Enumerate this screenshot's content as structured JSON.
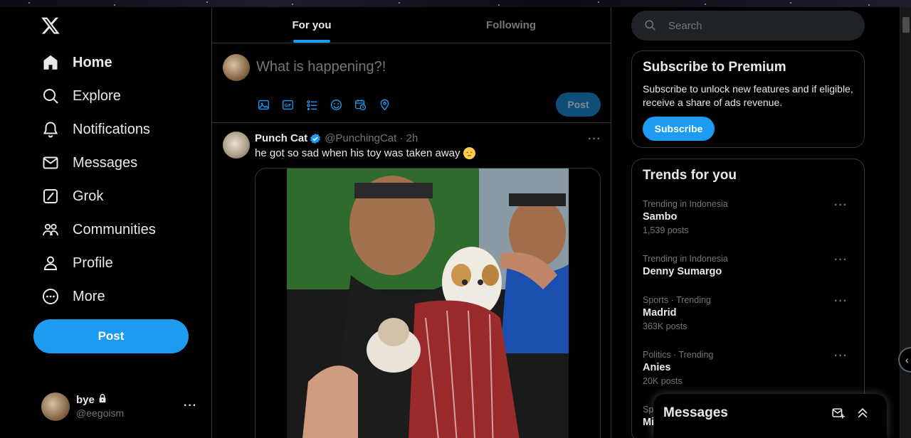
{
  "colors": {
    "accent": "#1d9bf0",
    "bg": "#000000",
    "border": "#2f3336",
    "muted": "#71767b",
    "text": "#e7e9ea"
  },
  "nav": {
    "items": [
      {
        "label": "Home",
        "icon": "home-icon",
        "active": true
      },
      {
        "label": "Explore",
        "icon": "search-icon"
      },
      {
        "label": "Notifications",
        "icon": "bell-icon"
      },
      {
        "label": "Messages",
        "icon": "envelope-icon"
      },
      {
        "label": "Grok",
        "icon": "grok-icon"
      },
      {
        "label": "Communities",
        "icon": "people-icon"
      },
      {
        "label": "Profile",
        "icon": "person-icon"
      },
      {
        "label": "More",
        "icon": "more-circle-icon"
      }
    ],
    "post_label": "Post",
    "account": {
      "name": "bye",
      "handle": "@eegoism"
    }
  },
  "tabs": [
    {
      "label": "For you",
      "active": true
    },
    {
      "label": "Following"
    }
  ],
  "composer": {
    "placeholder": "What is happening?!",
    "post_label": "Post",
    "tools": [
      "image-icon",
      "gif-icon",
      "poll-icon",
      "emoji-icon",
      "schedule-icon",
      "location-icon"
    ]
  },
  "tweet": {
    "name": "Punch Cat",
    "handle": "@PunchingCat · 2h",
    "text": "he got so sad when his toy was taken away"
  },
  "search": {
    "placeholder": "Search"
  },
  "premium": {
    "title": "Subscribe to Premium",
    "body": "Subscribe to unlock new features and if eligible, receive a share of ads revenue.",
    "button": "Subscribe"
  },
  "trends": {
    "title": "Trends for you",
    "items": [
      {
        "context": "Trending in Indonesia",
        "title": "Sambo",
        "count": "1,539 posts"
      },
      {
        "context": "Trending in Indonesia",
        "title": "Denny Sumargo",
        "count": ""
      },
      {
        "context": "Sports · Trending",
        "title": "Madrid",
        "count": "363K posts"
      },
      {
        "context": "Politics · Trending",
        "title": "Anies",
        "count": "20K posts"
      },
      {
        "context": "Sp",
        "title": "Mi",
        "count": ""
      }
    ]
  },
  "messages_dock": {
    "title": "Messages"
  }
}
